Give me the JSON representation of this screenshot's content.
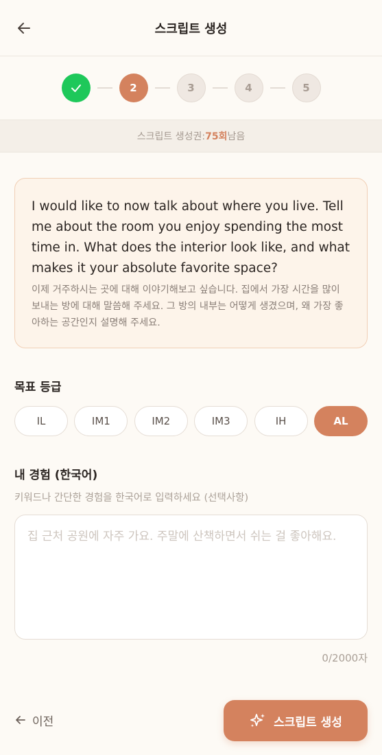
{
  "header": {
    "title": "스크립트 생성",
    "back_icon": "arrow-left-icon"
  },
  "stepper": {
    "steps": [
      {
        "label": "",
        "state": "done"
      },
      {
        "label": "2",
        "state": "active"
      },
      {
        "label": "3",
        "state": "pending"
      },
      {
        "label": "4",
        "state": "pending"
      },
      {
        "label": "5",
        "state": "pending"
      }
    ]
  },
  "quota": {
    "prefix": "스크립트 생성권: ",
    "count": "75회",
    "suffix": " 남음"
  },
  "question": {
    "english": "I would like to now talk about where you live. Tell me about the room you enjoy spending the most time in. What does the interior look like, and what makes it your absolute favorite space?",
    "korean": "이제 거주하시는 곳에 대해 이야기해보고 싶습니다. 집에서 가장 시간을 많이 보내는 방에 대해 말씀해 주세요. 그 방의 내부는 어떻게 생겼으며, 왜 가장 좋아하는 공간인지 설명해 주세요."
  },
  "target_grade": {
    "label": "목표 등급",
    "options": [
      "IL",
      "IM1",
      "IM2",
      "IM3",
      "IH",
      "AL"
    ],
    "selected": "AL"
  },
  "experience": {
    "label": "내 경험 (한국어)",
    "helper": "키워드나 간단한 경험을 한국어로 입력하세요 (선택사항)",
    "value": "",
    "placeholder": "집 근처 공원에 자주 가요. 주말에 산책하면서 쉬는 걸 좋아해요.",
    "char_count": "0/2000자"
  },
  "footer": {
    "prev_label": "이전",
    "generate_label": "스크립트 생성"
  },
  "colors": {
    "accent": "#d4825e",
    "success": "#1ec85a",
    "background": "#fdfaf5"
  }
}
